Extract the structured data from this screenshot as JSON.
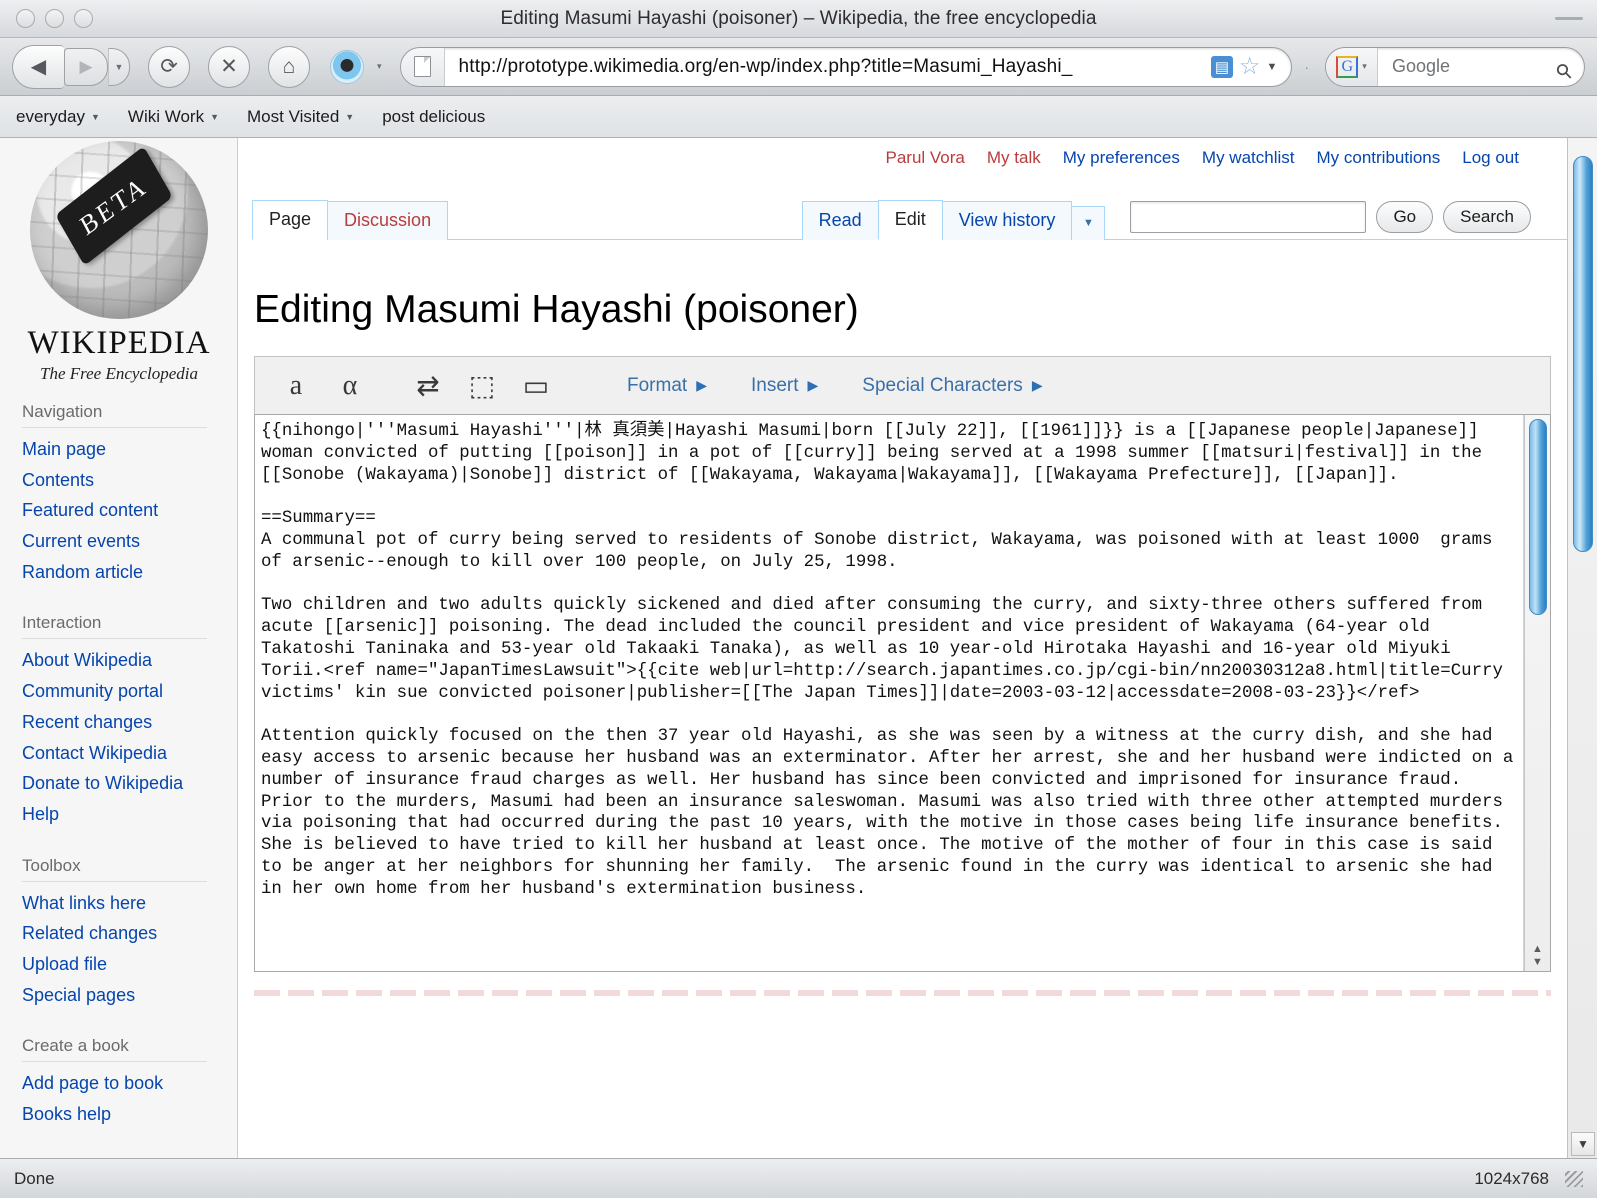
{
  "window": {
    "title": "Editing Masumi Hayashi (poisoner) – Wikipedia, the free encyclopedia"
  },
  "browser": {
    "url": "http://prototype.wikimedia.org/en-wp/index.php?title=Masumi_Hayashi_",
    "search_placeholder": "Google",
    "back_icon": "◀",
    "forward_icon": "▶",
    "nav_caret_icon": "▼",
    "reload_icon": "⟳",
    "stop_icon": "✕",
    "home_icon": "⌂",
    "favicon_caret_icon": "▾",
    "rss_icon": "▤",
    "star_icon": "☆",
    "url_caret_icon": "▼",
    "google_letter": "G",
    "google_caret_icon": "▾",
    "magnifier_icon": "⚲",
    "separator_dot": "·",
    "bookmarks": [
      {
        "label": "everyday",
        "has_caret": true
      },
      {
        "label": "Wiki Work",
        "has_caret": true
      },
      {
        "label": "Most Visited",
        "has_caret": true
      },
      {
        "label": "post delicious",
        "has_caret": false
      }
    ]
  },
  "statusbar": {
    "left": "Done",
    "size": "1024x768"
  },
  "sidebar": {
    "logo": {
      "beta_label": "BETA",
      "wordmark": "WIKIPEDIA",
      "tagline": "The Free Encyclopedia"
    },
    "sections": [
      {
        "heading": "Navigation",
        "links": [
          "Main page",
          "Contents",
          "Featured content",
          "Current events",
          "Random article"
        ]
      },
      {
        "heading": "Interaction",
        "links": [
          "About Wikipedia",
          "Community portal",
          "Recent changes",
          "Contact Wikipedia",
          "Donate to Wikipedia",
          "Help"
        ]
      },
      {
        "heading": "Toolbox",
        "links": [
          "What links here",
          "Related changes",
          "Upload file",
          "Special pages"
        ]
      },
      {
        "heading": "Create a book",
        "links": [
          "Add page to book",
          "Books help"
        ]
      }
    ]
  },
  "personal_links": [
    {
      "label": "Parul Vora",
      "new": true
    },
    {
      "label": "My talk",
      "new": true
    },
    {
      "label": "My preferences",
      "new": false
    },
    {
      "label": "My watchlist",
      "new": false
    },
    {
      "label": "My contributions",
      "new": false
    },
    {
      "label": "Log out",
      "new": false
    }
  ],
  "namespace_tabs": [
    {
      "label": "Page",
      "selected": true,
      "new": false
    },
    {
      "label": "Discussion",
      "selected": false,
      "new": true
    }
  ],
  "view_tabs": [
    {
      "label": "Read",
      "selected": false
    },
    {
      "label": "Edit",
      "selected": true
    },
    {
      "label": "View history",
      "selected": false
    }
  ],
  "view_tabs_caret": "▼",
  "search": {
    "value": "",
    "go_label": "Go",
    "search_label": "Search"
  },
  "page_title": "Editing Masumi Hayashi (poisoner)",
  "toolbar": {
    "icons": [
      {
        "name": "bold-a-icon",
        "glyph": "a"
      },
      {
        "name": "italic-alpha-icon",
        "glyph": "α"
      },
      {
        "name": "link-chain-icon",
        "glyph": "⇄"
      },
      {
        "name": "insert-image-icon",
        "glyph": "⬚"
      },
      {
        "name": "reference-book-icon",
        "glyph": "▭"
      }
    ],
    "menus": [
      {
        "label": "Format",
        "arrow": "▶"
      },
      {
        "label": "Insert",
        "arrow": "▶"
      },
      {
        "label": "Special Characters",
        "arrow": "▶"
      }
    ]
  },
  "wikitext": "{{nihongo|'''Masumi Hayashi'''|林 真須美|Hayashi Masumi|born [[July 22]], [[1961]]}} is a [[Japanese people|Japanese]] woman convicted of putting [[poison]] in a pot of [[curry]] being served at a 1998 summer [[matsuri|festival]] in the [[Sonobe (Wakayama)|Sonobe]] district of [[Wakayama, Wakayama|Wakayama]], [[Wakayama Prefecture]], [[Japan]].\n\n==Summary==\nA communal pot of curry being served to residents of Sonobe district, Wakayama, was poisoned with at least 1000  grams of arsenic--enough to kill over 100 people, on July 25, 1998.\n\nTwo children and two adults quickly sickened and died after consuming the curry, and sixty-three others suffered from acute [[arsenic]] poisoning. The dead included the council president and vice president of Wakayama (64-year old Takatoshi Taninaka and 53-year old Takaaki Tanaka), as well as 10 year-old Hirotaka Hayashi and 16-year old Miyuki Torii.<ref name=\"JapanTimesLawsuit\">{{cite web|url=http://search.japantimes.co.jp/cgi-bin/nn20030312a8.html|title=Curry victims' kin sue convicted poisoner|publisher=[[The Japan Times]]|date=2003-03-12|accessdate=2008-03-23}}</ref>\n\nAttention quickly focused on the then 37 year old Hayashi, as she was seen by a witness at the curry dish, and she had easy access to arsenic because her husband was an exterminator. After her arrest, she and her husband were indicted on a number of insurance fraud charges as well. Her husband has since been convicted and imprisoned for insurance fraud. Prior to the murders, Masumi had been an insurance saleswoman. Masumi was also tried with three other attempted murders via poisoning that had occurred during the past 10 years, with the motive in those cases being life insurance benefits. She is believed to have tried to kill her husband at least once. The motive of the mother of four in this case is said to be anger at her neighbors for shunning her family.  The arsenic found in the curry was identical to arsenic she had in her own home from her husband's extermination business.",
  "scroll": {
    "up_arrow": "▲",
    "down_arrow": "▼"
  }
}
